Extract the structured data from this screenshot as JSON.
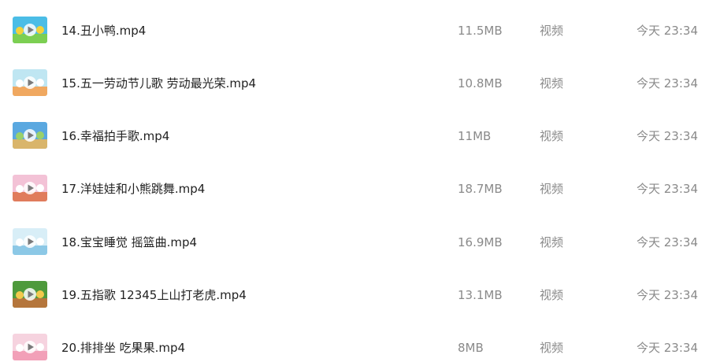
{
  "files": [
    {
      "name": "14.丑小鸭.mp4",
      "size": "11.5MB",
      "type": "视频",
      "time": "今天 23:34",
      "thumb": {
        "sky": "#4bbde6",
        "ground": "#7ccf52",
        "accent": "#f2d23a"
      }
    },
    {
      "name": "15.五一劳动节儿歌 劳动最光荣.mp4",
      "size": "10.8MB",
      "type": "视频",
      "time": "今天 23:34",
      "thumb": {
        "sky": "#bfe6f2",
        "ground": "#f0a860",
        "accent": "#ffffff"
      }
    },
    {
      "name": "16.幸福拍手歌.mp4",
      "size": "11MB",
      "type": "视频",
      "time": "今天 23:34",
      "thumb": {
        "sky": "#5aa8e0",
        "ground": "#d9b56b",
        "accent": "#9ad16a"
      }
    },
    {
      "name": "17.洋娃娃和小熊跳舞.mp4",
      "size": "18.7MB",
      "type": "视频",
      "time": "今天 23:34",
      "thumb": {
        "sky": "#f3c2d6",
        "ground": "#e07c5c",
        "accent": "#ffffff"
      }
    },
    {
      "name": "18.宝宝睡觉 摇篮曲.mp4",
      "size": "16.9MB",
      "type": "视频",
      "time": "今天 23:34",
      "thumb": {
        "sky": "#d8eef7",
        "ground": "#8cc8e6",
        "accent": "#ffffff"
      }
    },
    {
      "name": "19.五指歌 12345上山打老虎.mp4",
      "size": "13.1MB",
      "type": "视频",
      "time": "今天 23:34",
      "thumb": {
        "sky": "#4e9a3c",
        "ground": "#b5763c",
        "accent": "#f2c94c"
      }
    },
    {
      "name": "20.排排坐 吃果果.mp4",
      "size": "8MB",
      "type": "视频",
      "time": "今天 23:34",
      "thumb": {
        "sky": "#f6d3df",
        "ground": "#f2a0b8",
        "accent": "#ffffff"
      }
    }
  ]
}
